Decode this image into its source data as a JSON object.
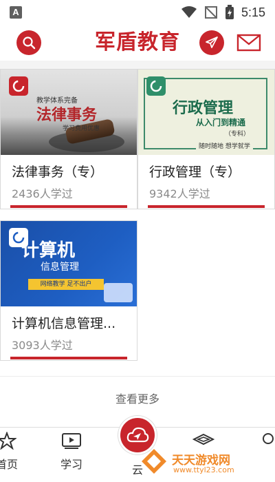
{
  "status_bar": {
    "time": "5:15",
    "notification_letter": "A"
  },
  "header": {
    "logo_text": "军盾教育"
  },
  "courses": [
    {
      "title": "法律事务（专）",
      "count": "2436人学过",
      "image": {
        "pre": "教学体系完备",
        "big": "法律事务",
        "sub": "学习费用优惠"
      }
    },
    {
      "title": "行政管理（专）",
      "count": "9342人学过",
      "image": {
        "big": "行政管理",
        "sub": "从入门到精通",
        "tag": "（专科）",
        "foot": "随时随地  想学就学"
      }
    },
    {
      "title": "计算机信息管理...",
      "count": "3093人学过",
      "image": {
        "big": "计算机",
        "sub": "信息管理",
        "ribbon": "网络教学 足不出户"
      }
    }
  ],
  "see_more": "查看更多",
  "nav": {
    "items": [
      {
        "label": "首页",
        "icon": "home-star-icon"
      },
      {
        "label": "学习",
        "icon": "video-book-icon"
      },
      {
        "label": "云",
        "icon": "cloud-send-icon"
      },
      {
        "label": "",
        "icon": "layers-icon"
      },
      {
        "label": "",
        "icon": "circle-icon"
      }
    ]
  },
  "watermark": {
    "name": "天天游戏网",
    "url": "www.ttyl23.com"
  },
  "colors": {
    "brand_red": "#c8252c",
    "green": "#2f8f6a",
    "blue": "#1e5ec2"
  }
}
